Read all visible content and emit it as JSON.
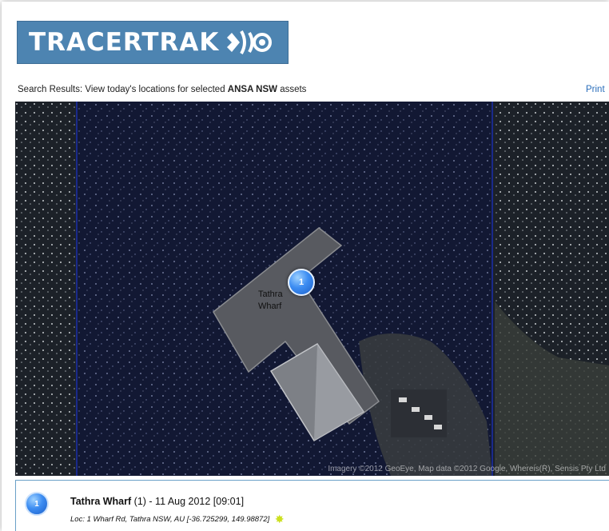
{
  "logo": {
    "text": "TRACERTRAK"
  },
  "search": {
    "prefix": "Search Results: View today's locations for selected",
    "group": "ANSA NSW",
    "suffix": "assets"
  },
  "print_label": "Print",
  "map": {
    "marker_number": "1",
    "place_label_line1": "Tathra",
    "place_label_line2": "Wharf",
    "attribution": "Imagery ©2012 GeoEye, Map data ©2012 Google, Whereis(R), Sensis Pty Ltd"
  },
  "result": {
    "marker_number": "1",
    "name": "Tathra Wharf",
    "count": "(1)",
    "date": "- 11 Aug 2012 [09:01]",
    "location": "Loc: 1 Wharf Rd, Tathra NSW, AU [-36.725299, 149.98872]",
    "status_icon": "star-icon"
  }
}
